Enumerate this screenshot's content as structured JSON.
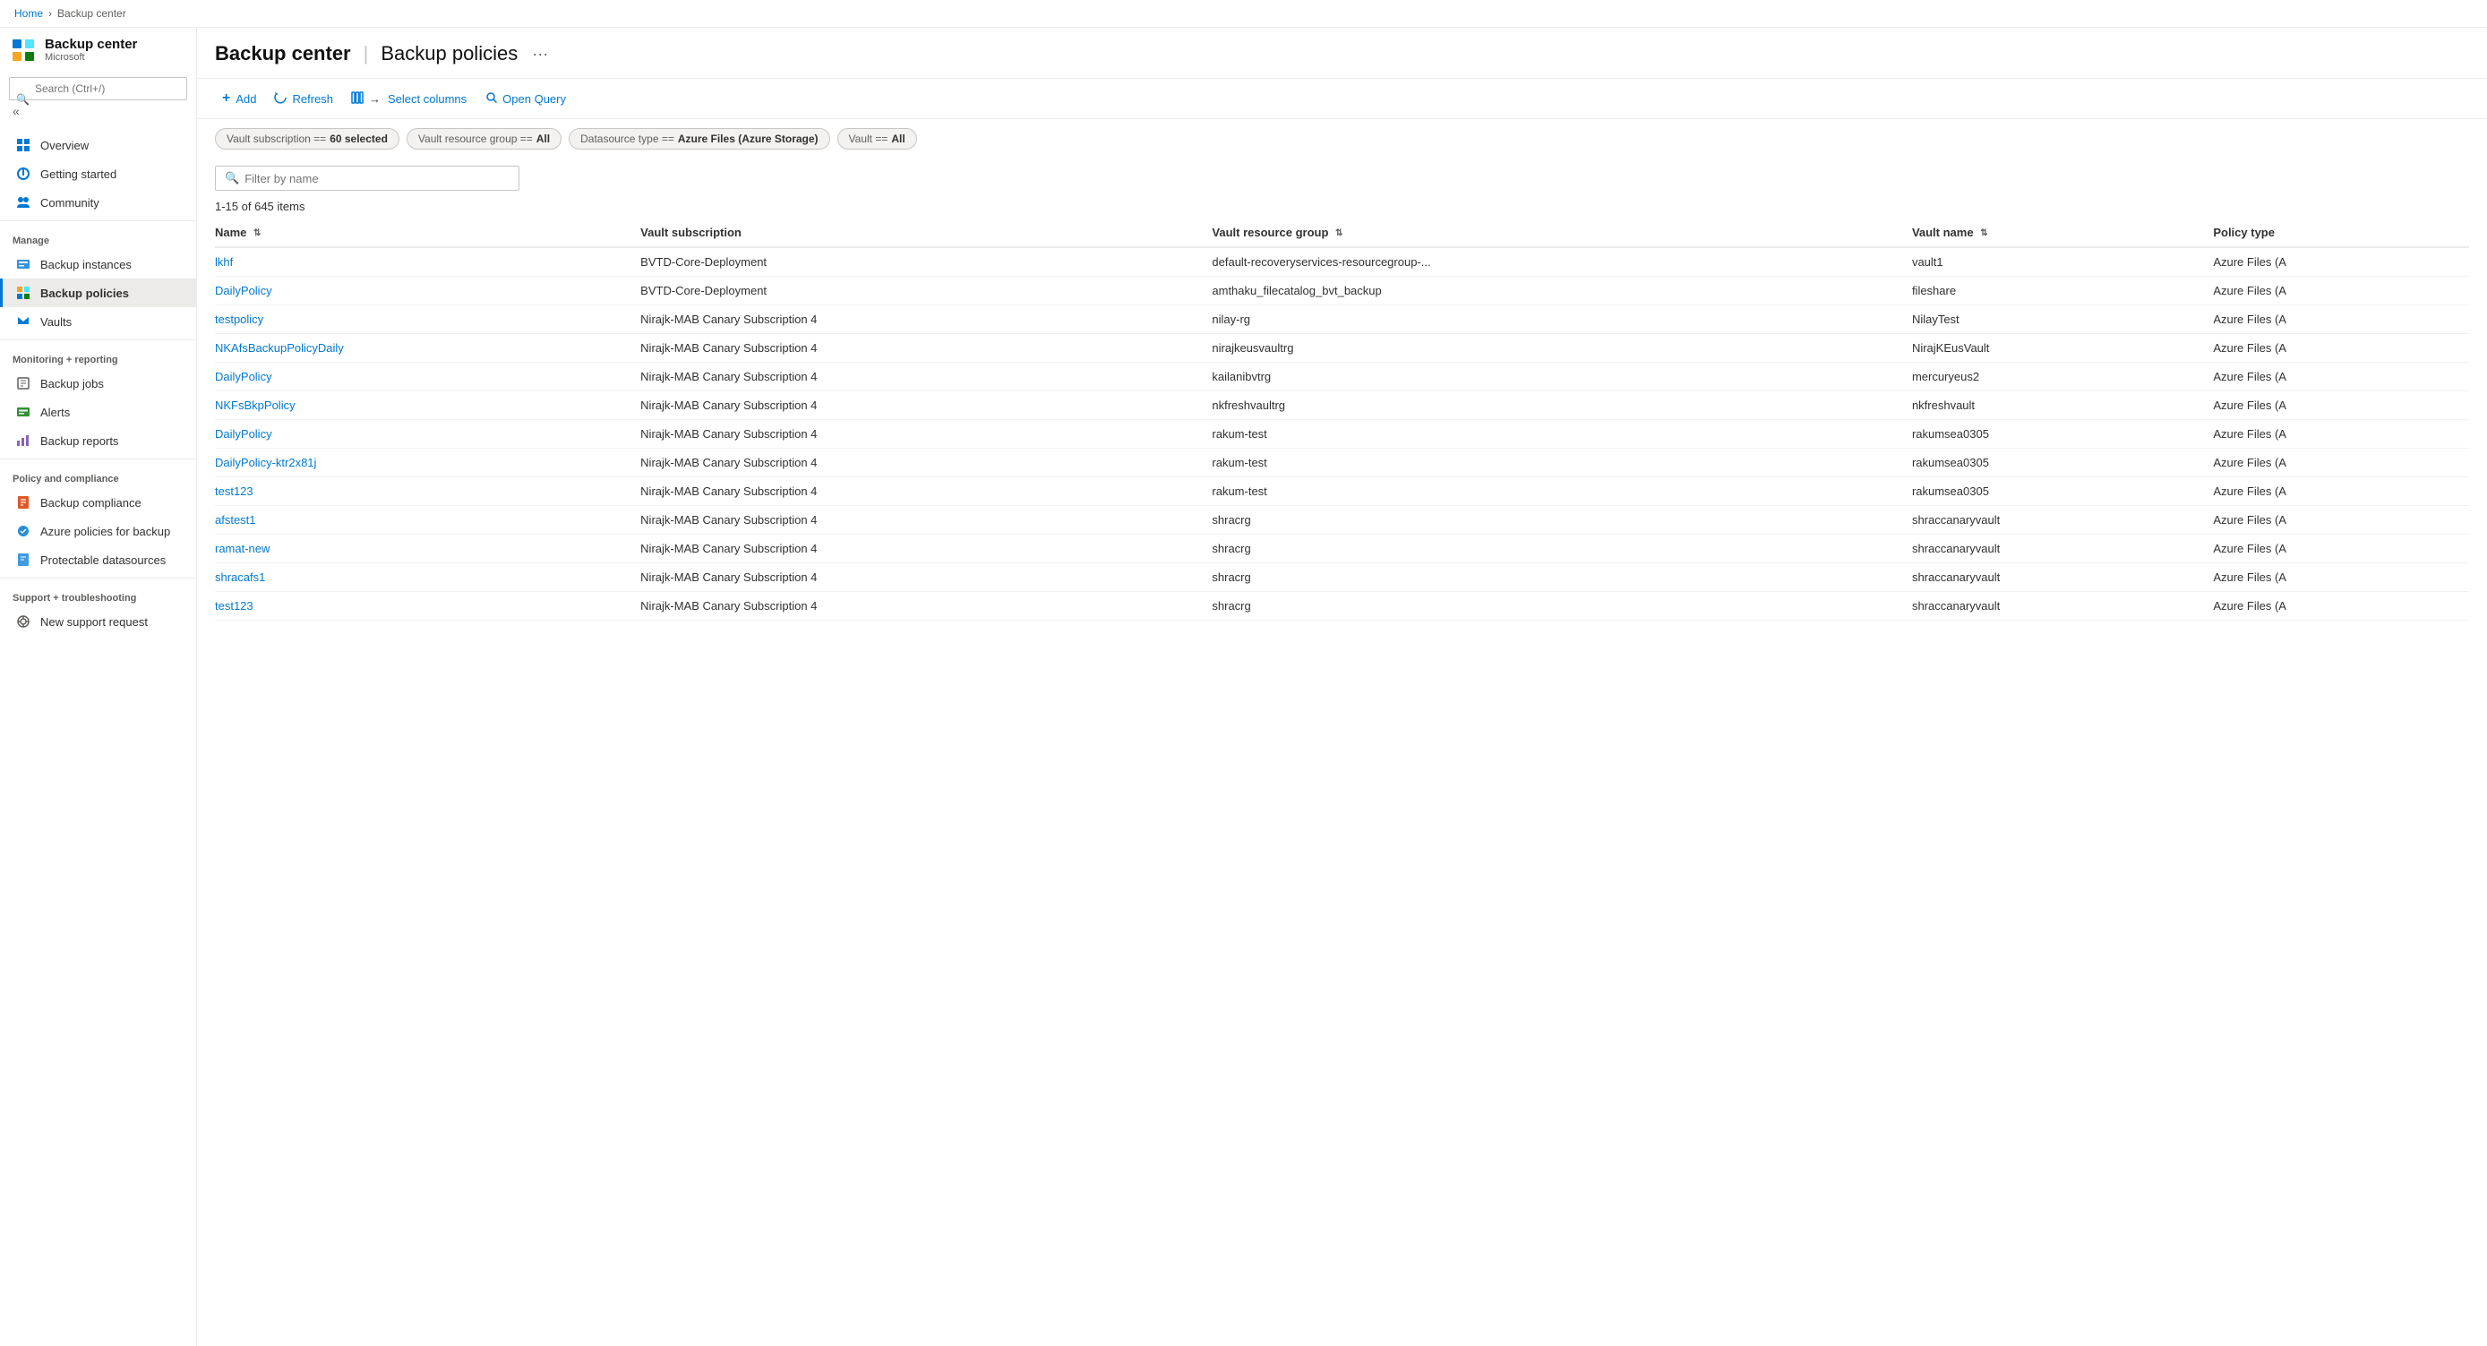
{
  "breadcrumb": {
    "home": "Home",
    "current": "Backup center"
  },
  "sidebar": {
    "app_title": "Backup center",
    "app_subtitle": "Microsoft",
    "search_placeholder": "Search (Ctrl+/)",
    "collapse_label": "«",
    "nav": {
      "overview": "Overview",
      "getting_started": "Getting started",
      "community": "Community",
      "manage_label": "Manage",
      "backup_instances": "Backup instances",
      "backup_policies": "Backup policies",
      "vaults": "Vaults",
      "monitoring_label": "Monitoring + reporting",
      "backup_jobs": "Backup jobs",
      "alerts": "Alerts",
      "backup_reports": "Backup reports",
      "policy_label": "Policy and compliance",
      "backup_compliance": "Backup compliance",
      "azure_policies": "Azure policies for backup",
      "protectable": "Protectable datasources",
      "support_label": "Support + troubleshooting",
      "new_support": "New support request"
    }
  },
  "header": {
    "title": "Backup center",
    "separator": "|",
    "subtitle": "Backup policies",
    "more_label": "···"
  },
  "toolbar": {
    "add_label": "Add",
    "refresh_label": "Refresh",
    "select_columns_label": "Select columns",
    "open_query_label": "Open Query"
  },
  "filters": [
    {
      "key": "Vault subscription",
      "op": "==",
      "value": "60 selected"
    },
    {
      "key": "Vault resource group",
      "op": "==",
      "value": "All"
    },
    {
      "key": "Datasource type",
      "op": "==",
      "value": "Azure Files (Azure Storage)"
    },
    {
      "key": "Vault",
      "op": "==",
      "value": "All"
    }
  ],
  "search": {
    "placeholder": "Filter by name"
  },
  "table": {
    "count_text": "1-15 of 645 items",
    "columns": [
      {
        "label": "Name",
        "sortable": true
      },
      {
        "label": "Vault subscription",
        "sortable": false
      },
      {
        "label": "Vault resource group",
        "sortable": true
      },
      {
        "label": "Vault name",
        "sortable": true
      },
      {
        "label": "Policy type",
        "sortable": false
      }
    ],
    "rows": [
      {
        "name": "lkhf",
        "subscription": "BVTD-Core-Deployment",
        "resource_group": "default-recoveryservices-resourcegroup-...",
        "vault_name": "vault1",
        "policy_type": "Azure Files (A"
      },
      {
        "name": "DailyPolicy",
        "subscription": "BVTD-Core-Deployment",
        "resource_group": "amthaku_filecatalog_bvt_backup",
        "vault_name": "fileshare",
        "policy_type": "Azure Files (A"
      },
      {
        "name": "testpolicy",
        "subscription": "Nirajk-MAB Canary Subscription 4",
        "resource_group": "nilay-rg",
        "vault_name": "NilayTest",
        "policy_type": "Azure Files (A"
      },
      {
        "name": "NKAfsBackupPolicyDaily",
        "subscription": "Nirajk-MAB Canary Subscription 4",
        "resource_group": "nirajkeusvaultrg",
        "vault_name": "NirajKEusVault",
        "policy_type": "Azure Files (A"
      },
      {
        "name": "DailyPolicy",
        "subscription": "Nirajk-MAB Canary Subscription 4",
        "resource_group": "kailanibvtrg",
        "vault_name": "mercuryeus2",
        "policy_type": "Azure Files (A"
      },
      {
        "name": "NKFsBkpPolicy",
        "subscription": "Nirajk-MAB Canary Subscription 4",
        "resource_group": "nkfreshvaultrg",
        "vault_name": "nkfreshvault",
        "policy_type": "Azure Files (A"
      },
      {
        "name": "DailyPolicy",
        "subscription": "Nirajk-MAB Canary Subscription 4",
        "resource_group": "rakum-test",
        "vault_name": "rakumsea0305",
        "policy_type": "Azure Files (A"
      },
      {
        "name": "DailyPolicy-ktr2x81j",
        "subscription": "Nirajk-MAB Canary Subscription 4",
        "resource_group": "rakum-test",
        "vault_name": "rakumsea0305",
        "policy_type": "Azure Files (A"
      },
      {
        "name": "test123",
        "subscription": "Nirajk-MAB Canary Subscription 4",
        "resource_group": "rakum-test",
        "vault_name": "rakumsea0305",
        "policy_type": "Azure Files (A"
      },
      {
        "name": "afstest1",
        "subscription": "Nirajk-MAB Canary Subscription 4",
        "resource_group": "shracrg",
        "vault_name": "shraccanaryvault",
        "policy_type": "Azure Files (A"
      },
      {
        "name": "ramat-new",
        "subscription": "Nirajk-MAB Canary Subscription 4",
        "resource_group": "shracrg",
        "vault_name": "shraccanaryvault",
        "policy_type": "Azure Files (A"
      },
      {
        "name": "shracafs1",
        "subscription": "Nirajk-MAB Canary Subscription 4",
        "resource_group": "shracrg",
        "vault_name": "shraccanaryvault",
        "policy_type": "Azure Files (A"
      },
      {
        "name": "test123",
        "subscription": "Nirajk-MAB Canary Subscription 4",
        "resource_group": "shracrg",
        "vault_name": "shraccanaryvault",
        "policy_type": "Azure Files (A"
      }
    ]
  }
}
